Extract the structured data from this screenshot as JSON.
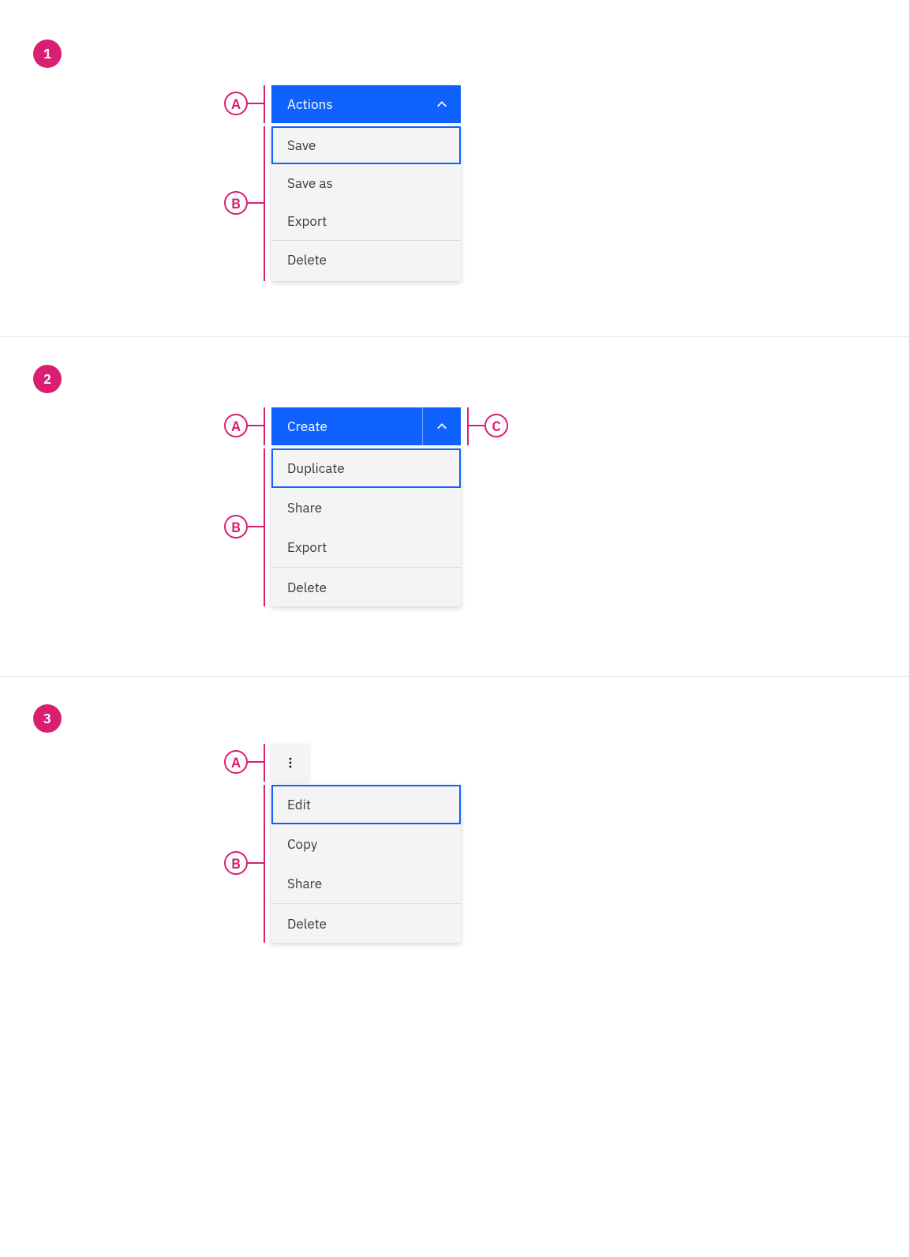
{
  "colors": {
    "primary": "#0f62fe",
    "annotation": "#da1e72",
    "menu_bg": "#f4f4f4",
    "text": "#393939"
  },
  "annotations": {
    "a": "A",
    "b": "B",
    "c": "C"
  },
  "examples": [
    {
      "step": "1",
      "button_label": "Actions",
      "chevron_dir": "up",
      "menu": [
        "Save",
        "Save as",
        "Export",
        "Delete"
      ]
    },
    {
      "step": "2",
      "button_label": "Create",
      "chevron_dir": "up",
      "menu": [
        "Duplicate",
        "Share",
        "Export",
        "Delete"
      ]
    },
    {
      "step": "3",
      "button_icon": "overflow-vertical",
      "menu": [
        "Edit",
        "Copy",
        "Share",
        "Delete"
      ]
    }
  ]
}
